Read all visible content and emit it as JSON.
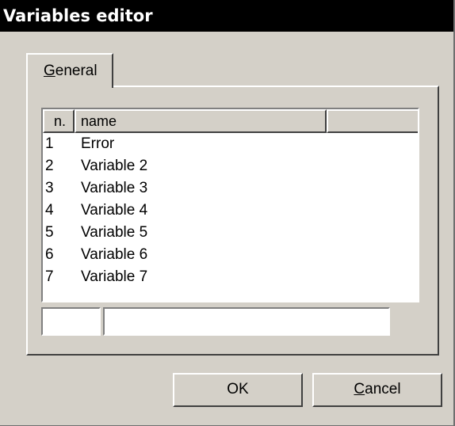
{
  "window": {
    "title": "Variables editor"
  },
  "tabs": [
    {
      "label_accel": "G",
      "label_rest": "eneral"
    }
  ],
  "list": {
    "columns": [
      "n.",
      "name",
      ""
    ],
    "rows": [
      {
        "n": "1",
        "name": "Error"
      },
      {
        "n": "2",
        "name": "Variable 2"
      },
      {
        "n": "3",
        "name": "Variable 3"
      },
      {
        "n": "4",
        "name": "Variable 4"
      },
      {
        "n": "5",
        "name": "Variable 5"
      },
      {
        "n": "6",
        "name": "Variable 6"
      },
      {
        "n": "7",
        "name": "Variable 7"
      }
    ]
  },
  "edit": {
    "number_value": "",
    "name_value": ""
  },
  "buttons": {
    "ok_label": "OK",
    "cancel_accel": "C",
    "cancel_rest": "ancel"
  }
}
